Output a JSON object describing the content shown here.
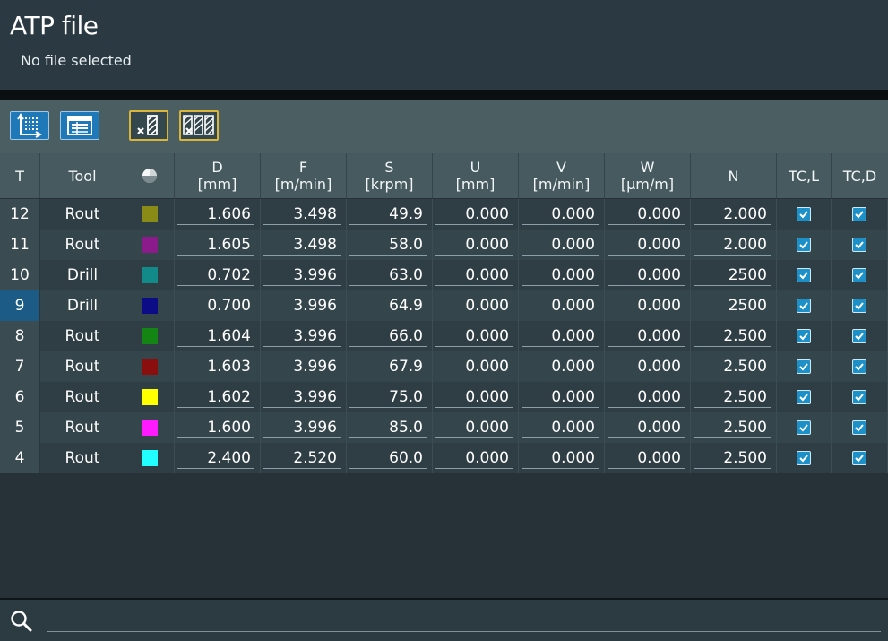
{
  "header": {
    "title": "ATP file",
    "subtitle": "No file selected"
  },
  "toolbar": {
    "buttons": [
      {
        "icon": "sort-axis-icon",
        "style": "blue"
      },
      {
        "icon": "table-view-icon",
        "style": "blue"
      },
      {
        "icon": "remove-tool-icon",
        "style": "yellow"
      },
      {
        "icon": "remove-all-tools-icon",
        "style": "yellow"
      }
    ]
  },
  "table": {
    "columns": [
      {
        "key": "t",
        "label": "T",
        "unit": ""
      },
      {
        "key": "tool",
        "label": "Tool",
        "unit": ""
      },
      {
        "key": "color",
        "label": "",
        "unit": ""
      },
      {
        "key": "d",
        "label": "D",
        "unit": "[mm]"
      },
      {
        "key": "f",
        "label": "F",
        "unit": "[m/min]"
      },
      {
        "key": "s",
        "label": "S",
        "unit": "[krpm]"
      },
      {
        "key": "u",
        "label": "U",
        "unit": "[mm]"
      },
      {
        "key": "v",
        "label": "V",
        "unit": "[m/min]"
      },
      {
        "key": "w",
        "label": "W",
        "unit": "[μm/m]"
      },
      {
        "key": "n",
        "label": "N",
        "unit": ""
      },
      {
        "key": "tcl",
        "label": "TC,L",
        "unit": ""
      },
      {
        "key": "tcd",
        "label": "TC,D",
        "unit": ""
      }
    ],
    "rows": [
      {
        "t": "12",
        "tool": "Rout",
        "color": "#8a8a16",
        "d": "1.606",
        "f": "3.498",
        "s": "49.9",
        "u": "0.000",
        "v": "0.000",
        "w": "0.000",
        "n": "2.000",
        "tcl": true,
        "tcd": true
      },
      {
        "t": "11",
        "tool": "Rout",
        "color": "#8b1a8b",
        "d": "1.605",
        "f": "3.498",
        "s": "58.0",
        "u": "0.000",
        "v": "0.000",
        "w": "0.000",
        "n": "2.000",
        "tcl": true,
        "tcd": true
      },
      {
        "t": "10",
        "tool": "Drill",
        "color": "#138a8a",
        "d": "0.702",
        "f": "3.996",
        "s": "63.0",
        "u": "0.000",
        "v": "0.000",
        "w": "0.000",
        "n": "2500",
        "tcl": true,
        "tcd": true
      },
      {
        "t": "9",
        "tool": "Drill",
        "color": "#0c0c86",
        "d": "0.700",
        "f": "3.996",
        "s": "64.9",
        "u": "0.000",
        "v": "0.000",
        "w": "0.000",
        "n": "2500",
        "tcl": true,
        "tcd": true,
        "active": true
      },
      {
        "t": "8",
        "tool": "Rout",
        "color": "#148514",
        "d": "1.604",
        "f": "3.996",
        "s": "66.0",
        "u": "0.000",
        "v": "0.000",
        "w": "0.000",
        "n": "2.500",
        "tcl": true,
        "tcd": true
      },
      {
        "t": "7",
        "tool": "Rout",
        "color": "#8a0e0e",
        "d": "1.603",
        "f": "3.996",
        "s": "67.9",
        "u": "0.000",
        "v": "0.000",
        "w": "0.000",
        "n": "2.500",
        "tcl": true,
        "tcd": true
      },
      {
        "t": "6",
        "tool": "Rout",
        "color": "#ffff00",
        "d": "1.602",
        "f": "3.996",
        "s": "75.0",
        "u": "0.000",
        "v": "0.000",
        "w": "0.000",
        "n": "2.500",
        "tcl": true,
        "tcd": true
      },
      {
        "t": "5",
        "tool": "Rout",
        "color": "#ff1aff",
        "d": "1.600",
        "f": "3.996",
        "s": "85.0",
        "u": "0.000",
        "v": "0.000",
        "w": "0.000",
        "n": "2.500",
        "tcl": true,
        "tcd": true
      },
      {
        "t": "4",
        "tool": "Rout",
        "color": "#22ffff",
        "d": "2.400",
        "f": "2.520",
        "s": "60.0",
        "u": "0.000",
        "v": "0.000",
        "w": "0.000",
        "n": "2.500",
        "tcl": true,
        "tcd": true
      }
    ]
  },
  "search": {
    "value": "",
    "placeholder": ""
  }
}
